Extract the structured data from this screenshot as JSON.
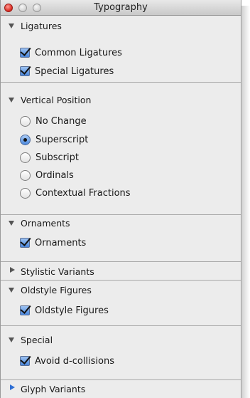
{
  "window": {
    "title": "Typography"
  },
  "ligatures": {
    "header": "Ligatures",
    "common": "Common Ligatures",
    "special": "Special Ligatures"
  },
  "vertical_position": {
    "header": "Vertical Position",
    "options": [
      "No Change",
      "Superscript",
      "Subscript",
      "Ordinals",
      "Contextual Fractions"
    ],
    "selected": "Superscript"
  },
  "ornaments": {
    "header": "Ornaments",
    "option": "Ornaments"
  },
  "stylistic_variants": {
    "header": "Stylistic Variants"
  },
  "oldstyle_figures": {
    "header": "Oldstyle Figures",
    "option": "Oldstyle Figures"
  },
  "special": {
    "header": "Special",
    "option": "Avoid d-collisions"
  },
  "glyph_variants": {
    "header": "Glyph Variants"
  },
  "colors": {
    "close": "#e0352b",
    "checkbox": "#4a87dc",
    "section_divider": "#a8a8a8"
  }
}
